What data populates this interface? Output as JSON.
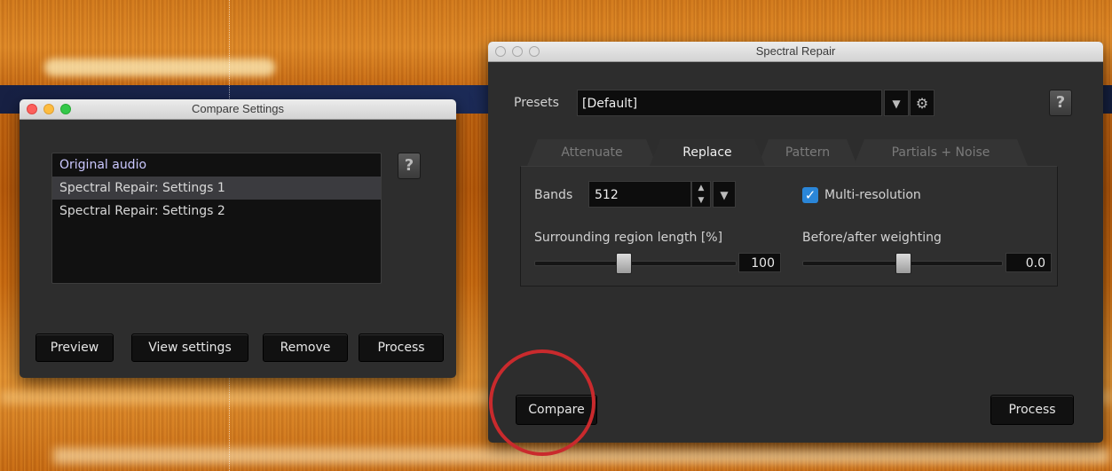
{
  "compare_window": {
    "title": "Compare Settings",
    "help": "?",
    "items": [
      "Original audio",
      "Spectral Repair: Settings 1",
      "Spectral Repair: Settings 2"
    ],
    "buttons": {
      "preview": "Preview",
      "view_settings": "View settings",
      "remove": "Remove",
      "process": "Process"
    }
  },
  "repair_window": {
    "title": "Spectral Repair",
    "help": "?",
    "presets_label": "Presets",
    "preset_value": "[Default]",
    "dropdown_arrow": "▼",
    "gear": "⚙",
    "tabs": [
      "Attenuate",
      "Replace",
      "Pattern",
      "Partials + Noise"
    ],
    "active_tab": "Replace",
    "bands_label": "Bands",
    "bands_value": "512",
    "multires_label": "Multi-resolution",
    "multires_checked": true,
    "surrounding_label": "Surrounding region length [%]",
    "surrounding_value": "100",
    "weighting_label": "Before/after weighting",
    "weighting_value": "0.0",
    "compare_button": "Compare",
    "process_button": "Process"
  },
  "colors": {
    "highlight_circle": "#c92a2d",
    "checkbox": "#2a86d8"
  }
}
